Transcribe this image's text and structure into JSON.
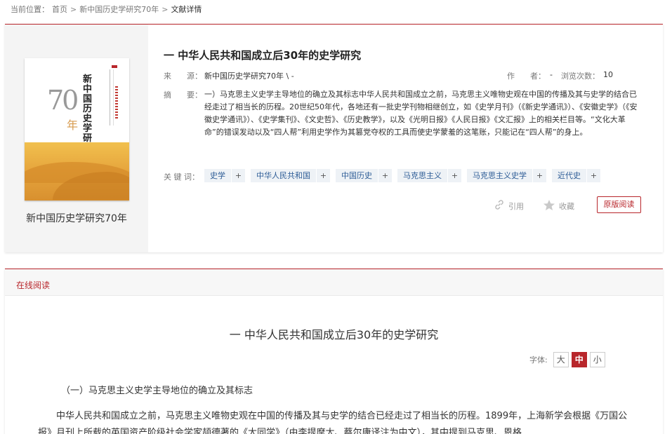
{
  "breadcrumb": {
    "prefix": "当前位置：",
    "items": [
      "首页",
      "新中国历史学研究70年"
    ],
    "separator": ">",
    "current": "文献详情"
  },
  "book": {
    "cover_number": "70",
    "cover_nian": "年",
    "cover_title": "新中国历史学研究",
    "caption": "新中国历史学研究70年"
  },
  "article": {
    "title": "一 中华人民共和国成立后30年的史学研究",
    "source_label": "来　　源：",
    "source_value": "新中国历史学研究70年 \\ -",
    "author_label": "作　　者：",
    "author_value": "-",
    "views_label": "浏览次数：",
    "views_value": "10",
    "abstract_label": "摘　　要：",
    "abstract": "一）马克思主义史学主导地位的确立及其标志中华人民共和国成立之前，马克思主义唯物史观在中国的传播及其与史学的结合已经走过了相当长的历程。20世纪50年代，各地还有一批史学刊物相继创立，如《史学月刊》（《新史学通讯》）、《安徽史学》（《安徽史学通讯》）、《史学集刊》、《文史哲》、《历史教学》，以及《光明日报》《人民日报》《文汇报》上的相关栏目等。“文化大革命”的错误发动以及“四人帮”利用史学作为其篡党夺权的工具而使史学蒙羞的这笔账，只能记在“四人帮”的身上。",
    "keywords_label": "关 键 词：",
    "keywords": [
      "史学",
      "中华人民共和国",
      "中国历史",
      "马克思主义",
      "马克思主义史学",
      "近代史"
    ],
    "keyword_add": "+",
    "cite_label": "引用",
    "favorite_label": "收藏",
    "original_read_label": "原版阅读"
  },
  "reader": {
    "header": "在线阅读",
    "title": "一 中华人民共和国成立后30年的史学研究",
    "font_label": "字体:",
    "font_sizes": [
      "大",
      "中",
      "小"
    ],
    "font_active": "中",
    "section_heading": "（一）马克思主义史学主导地位的确立及其标志",
    "paragraph": "中华人民共和国成立之前，马克思主义唯物史观在中国的传播及其与史学的结合已经走过了相当长的历程。1899年，上海新学会根据《万国公报》月刊上所载的英国资产阶级社会学家颉德著的《大同学》（由李提摩太、蔡尔康译注为中文），其中提到马克思、恩格"
  },
  "colors": {
    "accent": "#b8262b",
    "keyword_text": "#2d5c96",
    "keyword_bg": "#eef2f6"
  },
  "icons": {
    "cite": "link-icon",
    "favorite": "star-icon"
  }
}
